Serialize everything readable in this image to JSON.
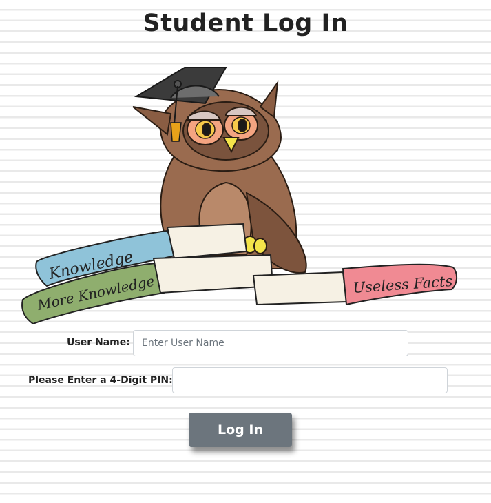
{
  "page": {
    "title": "Student Log In"
  },
  "illustration": {
    "book_labels": [
      "Knowledge",
      "More Knowledge",
      "Useless Facts"
    ]
  },
  "form": {
    "username_label": "User Name:",
    "username_placeholder": "Enter User Name",
    "username_value": "",
    "pin_label": "Please Enter a 4-Digit PIN:",
    "pin_value": "",
    "submit_label": "Log In"
  },
  "colors": {
    "button": "#6c757d",
    "book_blue": "#8fc3d9",
    "book_green": "#8fae6e",
    "book_pink": "#f08a93",
    "owl_brown": "#9a6b4f"
  }
}
